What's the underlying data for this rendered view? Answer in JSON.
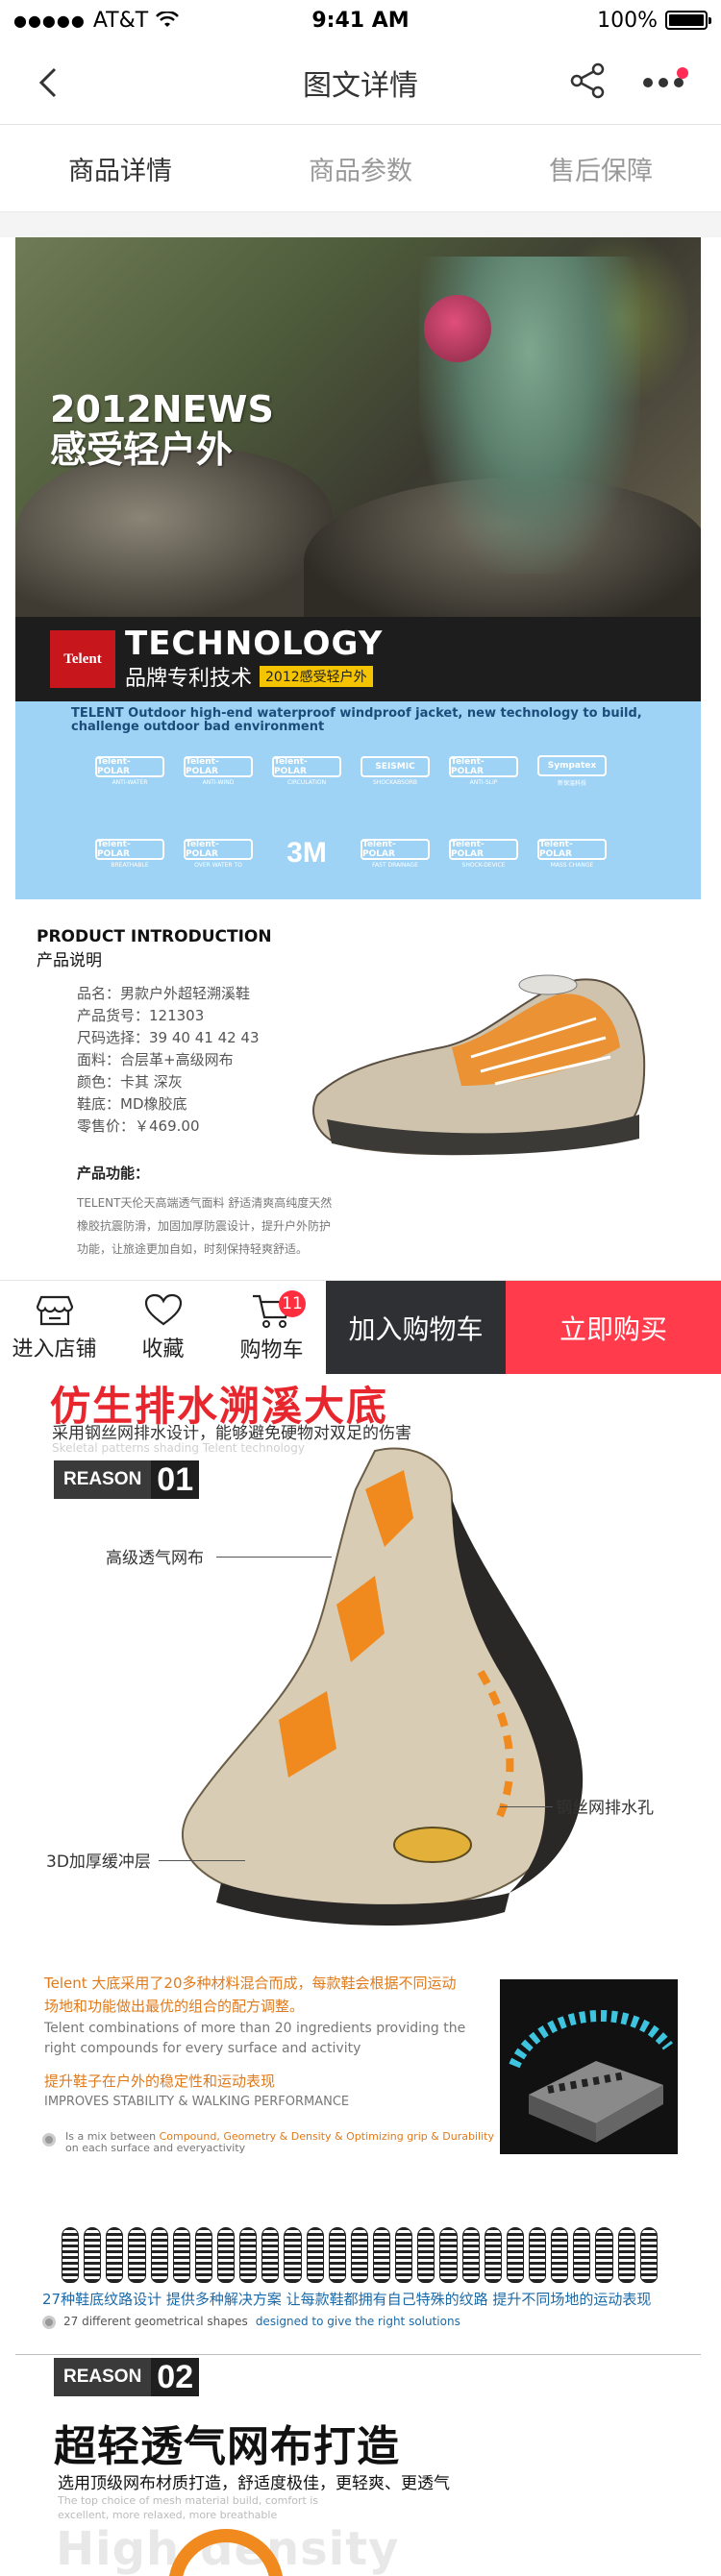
{
  "status_bar": {
    "carrier": "AT&T",
    "time": "9:41 AM",
    "battery": "100%"
  },
  "nav": {
    "title": "图文详情"
  },
  "tabs": [
    {
      "label": "商品详情"
    },
    {
      "label": "商品参数"
    },
    {
      "label": "售后保障"
    }
  ],
  "hero": {
    "headline_line1": "2012NEWS",
    "headline_line2": "感受轻户外"
  },
  "technology": {
    "logo": "Telent",
    "title": "TECHNOLOGY",
    "subtitle": "品牌专利技术",
    "tag": "2012感受轻户外",
    "description": "TELENT Outdoor high-end waterproof windproof jacket, new technology to build, challenge outdoor bad environment",
    "badges": [
      {
        "name": "Telent-POLAR",
        "sub": "ANTI-WATER"
      },
      {
        "name": "Telent-POLAR",
        "sub": "ANTI-WIND"
      },
      {
        "name": "Telent-POLAR",
        "sub": "CIRCULATION"
      },
      {
        "name": "SEISMIC",
        "sub": "SHOCKABSORB"
      },
      {
        "name": "Telent-POLAR",
        "sub": "ANTI-SLIP"
      },
      {
        "name": "Sympatex",
        "sub": "新保温科技"
      },
      {
        "name": "Telent-POLAR",
        "sub": "BREATHABLE"
      },
      {
        "name": "Telent-POLAR",
        "sub": "OVER WATER TO"
      },
      {
        "name": "3M",
        "sub": ""
      },
      {
        "name": "Telent-POLAR",
        "sub": "FAST DRAINAGE"
      },
      {
        "name": "Telent-POLAR",
        "sub": "SHOCK-DEVICE"
      },
      {
        "name": "Telent-POLAR",
        "sub": "MASS CHANGE"
      }
    ]
  },
  "intro": {
    "title": "PRODUCT INTRODUCTION",
    "subtitle": "产品说明",
    "specs": [
      "品名：男款户外超轻溯溪鞋",
      "产品货号：121303",
      "尺码选择：39 40 41 42 43",
      "面料：合层革+高级网布",
      "颜色：卡其  深灰",
      "鞋底：MD橡胶底",
      "零售价：￥469.00"
    ],
    "function_title": "产品功能：",
    "function_text": "TELENT天伦天高端透气面料 舒适清爽高纯度天然橡胶抗震防滑，加固加厚防震设计，提升户外防护功能，让旅途更加自如，时刻保持轻爽舒适。"
  },
  "bottom_bar": {
    "store": "进入店铺",
    "favorite": "收藏",
    "cart": "购物车",
    "cart_count": "11",
    "add_to_cart": "加入购物车",
    "buy_now": "立即购买"
  },
  "section1": {
    "headline": "仿生排水溯溪大底",
    "subtitle": "采用钢丝网排水设计，能够避免硬物对双足的伤害",
    "subtitle_en": "Skeletal patterns shading Telent technology",
    "reason_label": "REASON",
    "reason_num": "01",
    "callouts": [
      "高级透气网布",
      "钢丝网排水孔",
      "3D加厚缓冲层"
    ],
    "para_cn": "Telent 大底采用了20多种材料混合而成，每款鞋会根据不同运动场地和功能做出最优的组合的配方调整。",
    "para_en": "Telent combinations of more than 20 ingredients providing the right compounds for every surface and activity",
    "para_cn2": "提升鞋子在户外的稳定性和运动表现",
    "para_en2": "IMPROVES STABILITY & WALKING PERFORMANCE",
    "grip_pre": "Is a mix between",
    "grip_hl": "Compound, Geometry & Density & Optimizing grip & Durability",
    "grip_post": "on each surface and everyactivity"
  },
  "section2": {
    "soles_cn": "27种鞋底纹路设计 提供多种解决方案 让每款鞋都拥有自己特殊的纹路 提升不同场地的运动表现",
    "soles_en_pre": "27 different geometrical shapes",
    "soles_en_hl": "designed to give the right solutions",
    "reason_label": "REASON",
    "reason_num": "02",
    "headline": "超轻透气网布打造",
    "subtitle": "选用顶级网布材质打造，舒适度极佳，更轻爽、更透气",
    "subtitle_en": "The top choice of mesh material build, comfort is excellent, more relaxed, more breathable",
    "big_en": "High-density"
  },
  "colors": {
    "accent_red": "#ff3b4c",
    "dark": "#2f3034",
    "orange": "#e07a1a",
    "headline_red": "#e8262e"
  }
}
